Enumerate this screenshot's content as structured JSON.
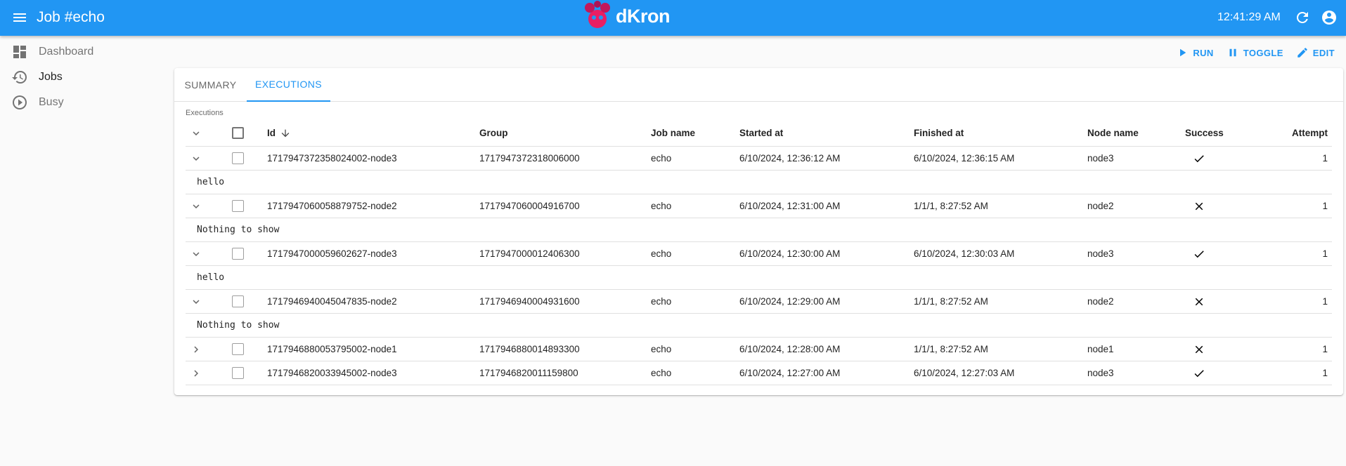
{
  "appbar": {
    "title": "Job #echo",
    "logo_text": "dKron",
    "time": "12:41:29 AM"
  },
  "sidebar": {
    "items": [
      {
        "label": "Dashboard",
        "icon": "dashboard-icon"
      },
      {
        "label": "Jobs",
        "icon": "history-icon"
      },
      {
        "label": "Busy",
        "icon": "play-circle-icon"
      }
    ]
  },
  "actions": {
    "run": "RUN",
    "toggle": "TOGGLE",
    "edit": "EDIT"
  },
  "tabs": [
    {
      "label": "SUMMARY",
      "active": false
    },
    {
      "label": "EXECUTIONS",
      "active": true
    }
  ],
  "executions": {
    "section_label": "Executions",
    "headers": {
      "id": "Id",
      "group": "Group",
      "job_name": "Job name",
      "started_at": "Started at",
      "finished_at": "Finished at",
      "node_name": "Node name",
      "success": "Success",
      "attempt": "Attempt"
    },
    "rows": [
      {
        "id": "1717947372358024002-node3",
        "group": "1717947372318006000",
        "job_name": "echo",
        "started_at": "6/10/2024, 12:36:12 AM",
        "finished_at": "6/10/2024, 12:36:15 AM",
        "node_name": "node3",
        "success": true,
        "attempt": "1",
        "expanded": true,
        "output": "hello"
      },
      {
        "id": "1717947060058879752-node2",
        "group": "1717947060004916700",
        "job_name": "echo",
        "started_at": "6/10/2024, 12:31:00 AM",
        "finished_at": "1/1/1, 8:27:52 AM",
        "node_name": "node2",
        "success": false,
        "attempt": "1",
        "expanded": true,
        "output": "Nothing to show"
      },
      {
        "id": "1717947000059602627-node3",
        "group": "1717947000012406300",
        "job_name": "echo",
        "started_at": "6/10/2024, 12:30:00 AM",
        "finished_at": "6/10/2024, 12:30:03 AM",
        "node_name": "node3",
        "success": true,
        "attempt": "1",
        "expanded": true,
        "output": "hello"
      },
      {
        "id": "1717946940045047835-node2",
        "group": "1717946940004931600",
        "job_name": "echo",
        "started_at": "6/10/2024, 12:29:00 AM",
        "finished_at": "1/1/1, 8:27:52 AM",
        "node_name": "node2",
        "success": false,
        "attempt": "1",
        "expanded": true,
        "output": "Nothing to show"
      },
      {
        "id": "1717946880053795002-node1",
        "group": "1717946880014893300",
        "job_name": "echo",
        "started_at": "6/10/2024, 12:28:00 AM",
        "finished_at": "1/1/1, 8:27:52 AM",
        "node_name": "node1",
        "success": false,
        "attempt": "1",
        "expanded": false,
        "output": ""
      },
      {
        "id": "1717946820033945002-node3",
        "group": "1717946820011159800",
        "job_name": "echo",
        "started_at": "6/10/2024, 12:27:00 AM",
        "finished_at": "6/10/2024, 12:27:03 AM",
        "node_name": "node3",
        "success": true,
        "attempt": "1",
        "expanded": false,
        "output": ""
      }
    ]
  },
  "colors": {
    "primary": "#2196f3",
    "logo_pink": "#e91e63"
  }
}
